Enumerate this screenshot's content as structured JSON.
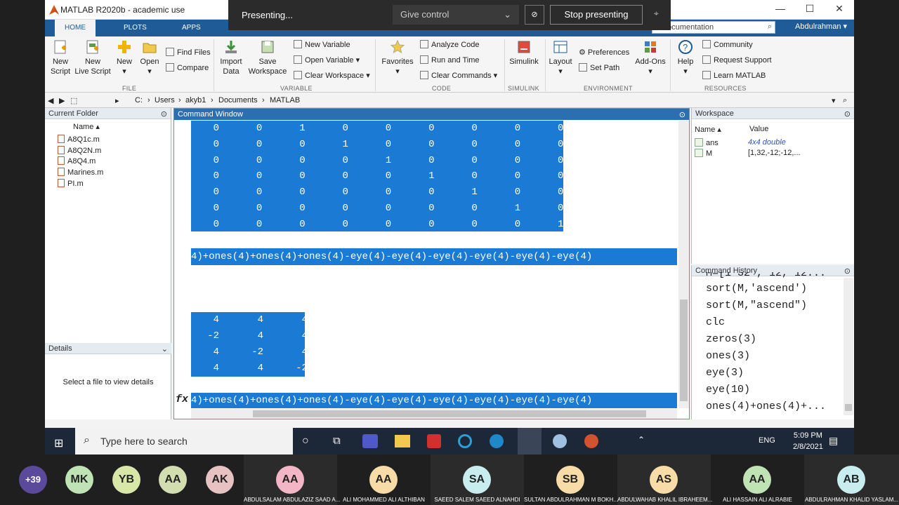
{
  "window": {
    "title": "MATLAB R2020b - academic use",
    "min": "—",
    "max": "☐",
    "close": "✕"
  },
  "tabs": [
    "HOME",
    "PLOTS",
    "APPS"
  ],
  "search": {
    "placeholder": "Search Documentation",
    "visible_text": "h Documentation"
  },
  "user": "Abdulrahman ▾",
  "ribbon": {
    "new_script": [
      "New",
      "Script"
    ],
    "new_live": [
      "New",
      "Live Script"
    ],
    "new": "New",
    "open": "Open",
    "find_files": "Find Files",
    "compare": "Compare",
    "import_data": [
      "Import",
      "Data"
    ],
    "save_ws": [
      "Save",
      "Workspace"
    ],
    "new_var": "New Variable",
    "open_var": "Open Variable ▾",
    "clear_ws": "Clear Workspace ▾",
    "favorites": "Favorites",
    "analyze": "Analyze Code",
    "run_time": "Run and Time",
    "clear_cmds": "Clear Commands ▾",
    "simulink": "Simulink",
    "layout": "Layout",
    "preferences": "Preferences",
    "set_path": "Set Path",
    "addons": "Add-Ons",
    "help": "Help",
    "community": "Community",
    "request": "Request Support",
    "learn": "Learn MATLAB",
    "groups": [
      "FILE",
      "VARIABLE",
      "CODE",
      "SIMULINK",
      "ENVIRONMENT",
      "RESOURCES"
    ]
  },
  "path": [
    "C:",
    "Users",
    "akyb1",
    "Documents",
    "MATLAB"
  ],
  "current_folder": {
    "title": "Current Folder",
    "col": "Name ▴",
    "files": [
      "A8Q1c.m",
      "A8Q2N.m",
      "A8Q4.m",
      "Marines.m",
      "PI.m"
    ]
  },
  "details": {
    "title": "Details",
    "empty": "Select a file to view details"
  },
  "command_window": {
    "title": "Command Window",
    "matrix_rows": [
      [
        "0",
        "0",
        "1",
        "0",
        "0",
        "0",
        "0",
        "0",
        "0"
      ],
      [
        "0",
        "0",
        "0",
        "1",
        "0",
        "0",
        "0",
        "0",
        "0"
      ],
      [
        "0",
        "0",
        "0",
        "0",
        "1",
        "0",
        "0",
        "0",
        "0"
      ],
      [
        "0",
        "0",
        "0",
        "0",
        "0",
        "1",
        "0",
        "0",
        "0"
      ],
      [
        "0",
        "0",
        "0",
        "0",
        "0",
        "0",
        "1",
        "0",
        "0"
      ],
      [
        "0",
        "0",
        "0",
        "0",
        "0",
        "0",
        "0",
        "1",
        "0"
      ],
      [
        "0",
        "0",
        "0",
        "0",
        "0",
        "0",
        "0",
        "0",
        "1"
      ]
    ],
    "cmd1": "4)+ones(4)+ones(4)+ones(4)-eye(4)-eye(4)-eye(4)-eye(4)-eye(4)-eye(4)",
    "small_rows": [
      [
        "4",
        "4",
        "4"
      ],
      [
        "-2",
        "4",
        "4"
      ],
      [
        "4",
        "-2",
        "4"
      ],
      [
        "4",
        "4",
        "-2"
      ]
    ],
    "prompt_line": "4)+ones(4)+ones(4)+ones(4)-eye(4)-eye(4)-eye(4)-eye(4)-eye(4)-eye(4)",
    "fx": "fx"
  },
  "workspace": {
    "title": "Workspace",
    "cols": [
      "Name ▴",
      "Value"
    ],
    "vars": [
      {
        "name": "ans",
        "value": "4x4 double"
      },
      {
        "name": "M",
        "value": "[1,32,-12;-12,..."
      }
    ]
  },
  "history": {
    "title": "Command History",
    "top_partial": "M=[1 32 , 12, 12...",
    "items": [
      "sort(M,'ascend')",
      "sort(M,\"ascend\")",
      "clc",
      "zeros(3)",
      "ones(3)",
      "eye(3)",
      "eye(10)",
      "ones(4)+ones(4)+..."
    ]
  },
  "taskbar": {
    "search": "Type here to search",
    "time": "5:09 PM",
    "date": "2/8/2021",
    "lang": "ENG"
  },
  "zoom": {
    "presenting": "Presenting...",
    "give_control": "Give control",
    "stop": "Stop presenting"
  },
  "participants": {
    "more": "+39",
    "initials": [
      "MK",
      "YB",
      "AA",
      "AK"
    ],
    "named": [
      {
        "i": "AA",
        "name": "ABDULSALAM ABDULAZIZ SAAD A..."
      },
      {
        "i": "AA",
        "name": "ALI MOHAMMED ALI ALTHIBAN"
      },
      {
        "i": "SA",
        "name": "SAEED SALEM SAEED ALNAHDI"
      },
      {
        "i": "SB",
        "name": "SULTAN ABDULRAHMAN M BOKH..."
      },
      {
        "i": "AS",
        "name": "ABDULWAHAB KHALIL IBRAHEEM..."
      },
      {
        "i": "AA",
        "name": "ALI HASSAIN ALI ALRABIE"
      },
      {
        "i": "AB",
        "name": "ABDULRAHMAN KHALID YASLAM..."
      }
    ]
  },
  "colors": {
    "matlab_blue": "#1e5b97",
    "selection": "#1a7ad4",
    "taskbar": "#1c2738"
  }
}
